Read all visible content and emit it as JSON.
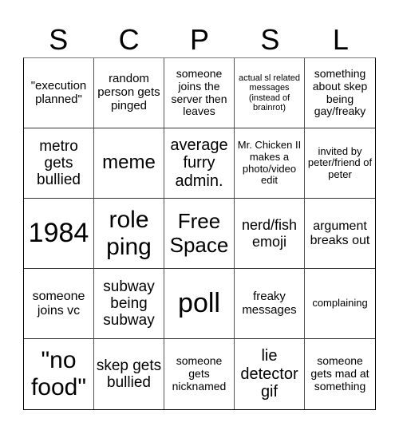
{
  "header": {
    "letters": [
      "S",
      "C",
      "P",
      "S",
      "L"
    ]
  },
  "cells": [
    [
      "\"execution planned\"",
      "random person gets pinged",
      "someone joins the server then leaves",
      "actual sl related messages (instead of brainrot)",
      "something about skep being gay/freaky"
    ],
    [
      "metro gets bullied",
      "meme",
      "average furry admin.",
      "Mr. Chicken II makes a photo/video edit",
      "invited by peter/friend of peter"
    ],
    [
      "1984",
      "role ping",
      "Free Space",
      "nerd/fish emoji",
      "argument breaks out"
    ],
    [
      "someone joins vc",
      "subway being subway",
      "poll",
      "freaky messages",
      "complaining"
    ],
    [
      "\"no food\"",
      "skep gets bullied",
      "someone gets nicknamed",
      "lie detector gif",
      "someone gets mad at something"
    ]
  ]
}
